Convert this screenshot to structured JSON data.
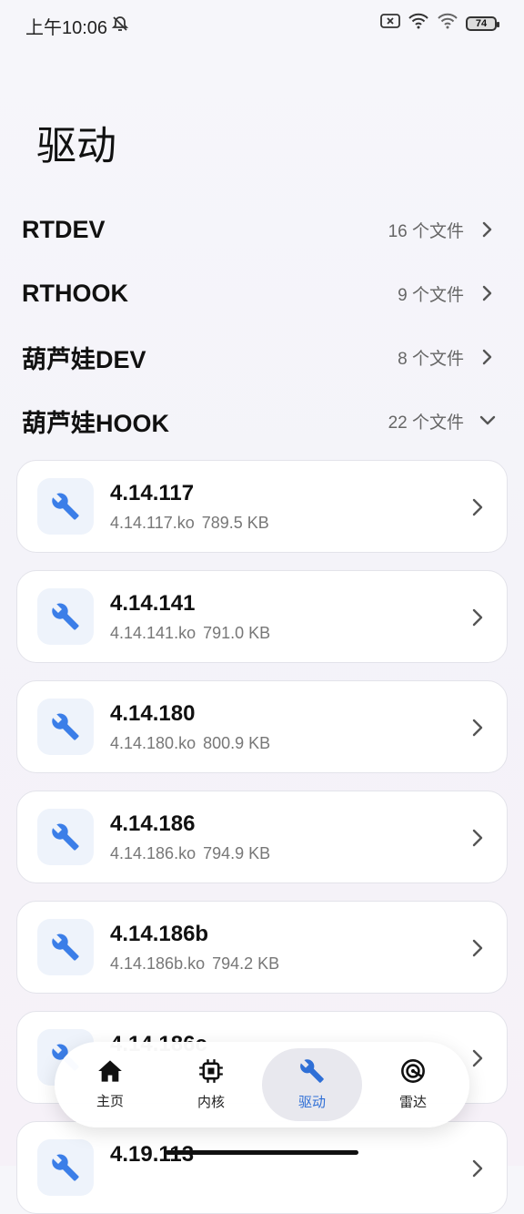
{
  "status_bar": {
    "time": "上午10:06",
    "battery": "74"
  },
  "page_title": "驱动",
  "groups": [
    {
      "name": "RTDEV",
      "count": "16 个文件",
      "expanded": false
    },
    {
      "name": "RTHOOK",
      "count": "9 个文件",
      "expanded": false
    },
    {
      "name": "葫芦娃DEV",
      "count": "8 个文件",
      "expanded": false
    },
    {
      "name": "葫芦娃HOOK",
      "count": "22 个文件",
      "expanded": true
    }
  ],
  "files": [
    {
      "title": "4.14.117",
      "filename": "4.14.117.ko",
      "size": "789.5 KB"
    },
    {
      "title": "4.14.141",
      "filename": "4.14.141.ko",
      "size": "791.0 KB"
    },
    {
      "title": "4.14.180",
      "filename": "4.14.180.ko",
      "size": "800.9 KB"
    },
    {
      "title": "4.14.186",
      "filename": "4.14.186.ko",
      "size": "794.9 KB"
    },
    {
      "title": "4.14.186b",
      "filename": "4.14.186b.ko",
      "size": "794.2 KB"
    },
    {
      "title": "4.14.186c",
      "filename": "",
      "size": ""
    },
    {
      "title": "4.19.113",
      "filename": "",
      "size": ""
    }
  ],
  "tabs": [
    {
      "label": "主页",
      "icon": "home-icon",
      "active": false
    },
    {
      "label": "内核",
      "icon": "chip-icon",
      "active": false
    },
    {
      "label": "驱动",
      "icon": "wrench-icon",
      "active": true
    },
    {
      "label": "雷达",
      "icon": "radar-icon",
      "active": false
    }
  ],
  "colors": {
    "accent": "#2f6fd6",
    "icon": "#3b7ee8",
    "icon_bg": "#eef3fb"
  }
}
